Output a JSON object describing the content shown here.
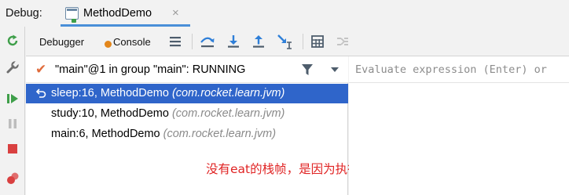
{
  "titlebar": {
    "label": "Debug:",
    "tab_label": "MethodDemo",
    "tab_close": "×"
  },
  "toolbar": {
    "debugger_tab": "Debugger",
    "console_tab": "Console"
  },
  "thread": {
    "text": "\"main\"@1 in group \"main\": RUNNING"
  },
  "frames": [
    {
      "method": "sleep:16, MethodDemo",
      "package": "(com.rocket.learn.jvm)",
      "selected": true
    },
    {
      "method": "study:10, MethodDemo",
      "package": "(com.rocket.learn.jvm)",
      "selected": false
    },
    {
      "method": "main:6, MethodDemo",
      "package": "(com.rocket.learn.jvm)",
      "selected": false
    }
  ],
  "annotation": "没有eat的栈帧，是因为执行完后就被销毁",
  "evaluate": {
    "placeholder": "Evaluate expression (Enter) or"
  },
  "colors": {
    "selection": "#2f65ca",
    "tab_underline": "#4a8fd8",
    "annotation": "#e02323",
    "resume_green": "#3f9f4a",
    "stop_red": "#d94040"
  }
}
